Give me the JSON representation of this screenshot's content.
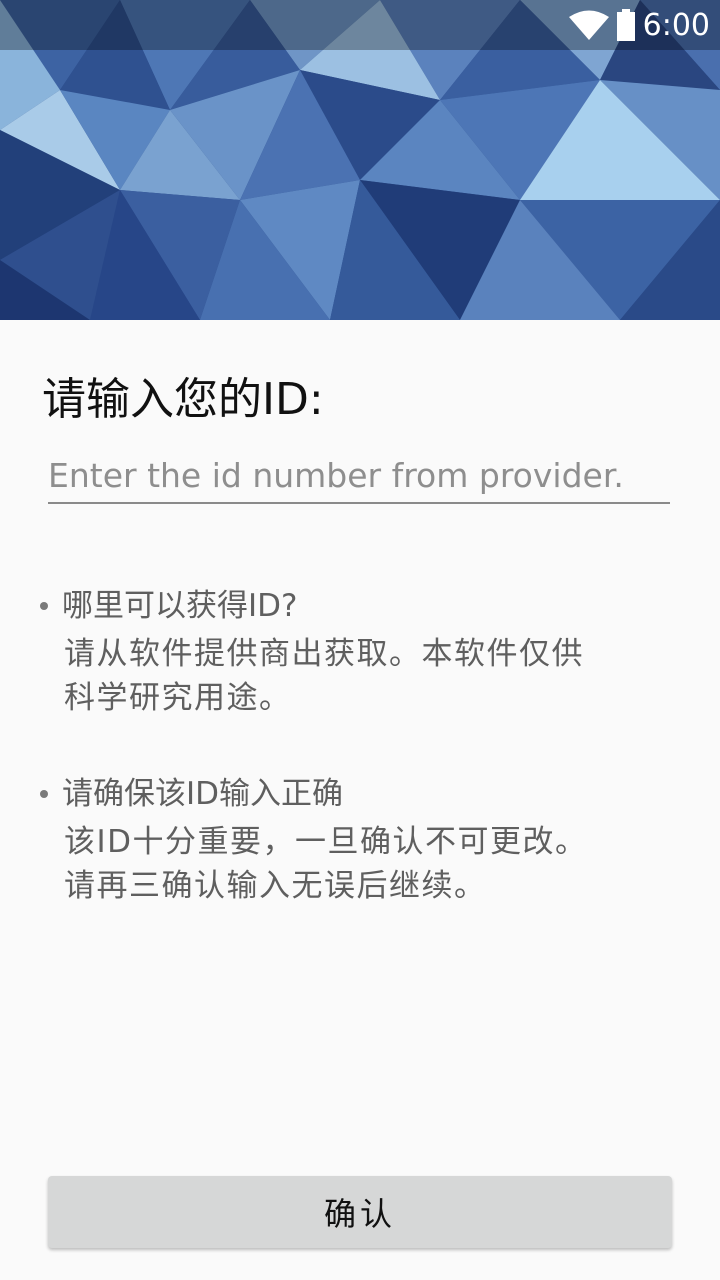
{
  "status_bar": {
    "time": "6:00",
    "wifi_icon": "wifi-icon",
    "battery_icon": "battery-icon"
  },
  "header_image": {
    "description_icon": "polygon-background-image"
  },
  "form": {
    "title": "请输入您的ID:",
    "id_placeholder": "Enter the id number from provider.",
    "id_value": ""
  },
  "tips": [
    {
      "title": "哪里可以获得ID?",
      "body": "请从软件提供商出获取。本软件仅供\n科学研究用途。"
    },
    {
      "title": "请确保该ID输入正确",
      "body": "该ID十分重要，一旦确认不可更改。\n请再三确认输入无误后继续。"
    }
  ],
  "confirm_label": "确认",
  "colors": {
    "background": "#fafafa",
    "button": "#d6d7d7",
    "input_underline": "#8a8a8a",
    "hero_blue": "#2a4a86"
  }
}
